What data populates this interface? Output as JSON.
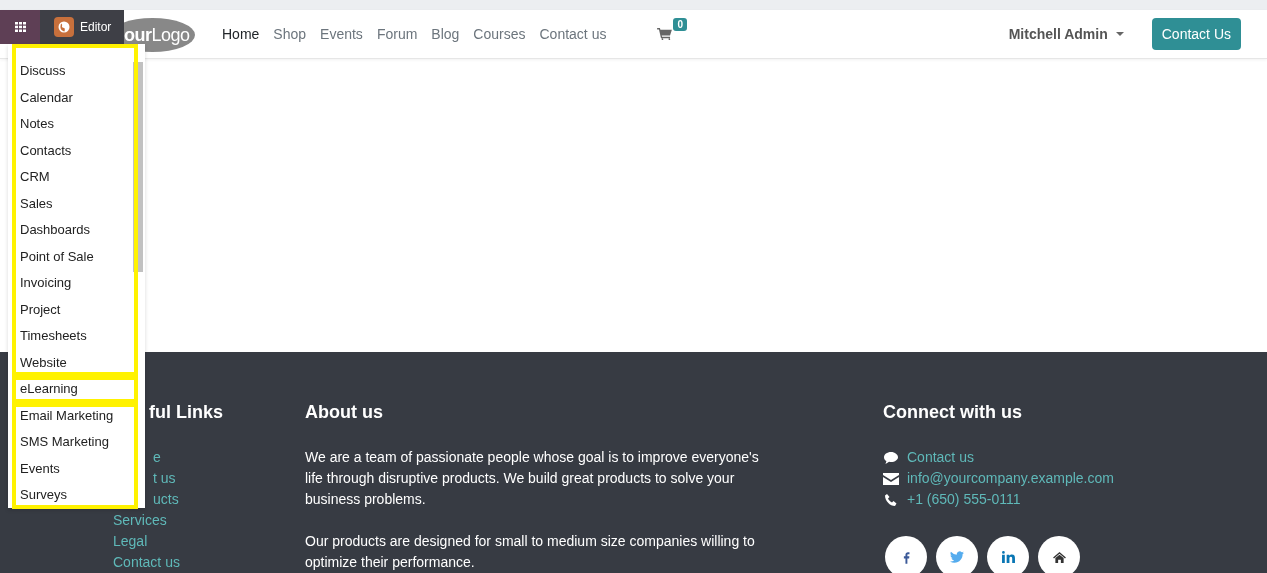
{
  "editor_bar": {
    "editor_label": "Editor"
  },
  "navbar": {
    "logo": "**our**Logo",
    "links": [
      {
        "label": "Home",
        "selected": true
      },
      {
        "label": "Shop",
        "selected": false
      },
      {
        "label": "Events",
        "selected": false
      },
      {
        "label": "Forum",
        "selected": false
      },
      {
        "label": "Blog",
        "selected": false
      },
      {
        "label": "Courses",
        "selected": false
      },
      {
        "label": "Contact us",
        "selected": false
      }
    ],
    "cart_count": "0",
    "user": "Mitchell Admin",
    "cta": "Contact Us"
  },
  "app_menu": {
    "groups": [
      {
        "highlighted": true,
        "items": [
          "Discuss",
          "Calendar",
          "Notes",
          "Contacts",
          "CRM",
          "Sales",
          "Dashboards",
          "Point of Sale",
          "Invoicing",
          "Project",
          "Timesheets",
          "Website"
        ]
      },
      {
        "highlighted": true,
        "items": [
          "eLearning"
        ]
      },
      {
        "highlighted": true,
        "items": [
          "Email Marketing",
          "SMS Marketing",
          "Events",
          "Surveys"
        ]
      }
    ]
  },
  "footer": {
    "useful_links": {
      "title": "ful Links",
      "links": [
        {
          "text": "e",
          "clipped": true
        },
        {
          "text": "t us",
          "clipped": true
        },
        {
          "text": "ucts",
          "clipped": true
        },
        {
          "text": "Services",
          "clipped": false
        },
        {
          "text": "Legal",
          "clipped": false
        },
        {
          "text": "Contact us",
          "clipped": false
        }
      ]
    },
    "about": {
      "title": "About us",
      "paragraphs": [
        "We are a team of passionate people whose goal is to improve everyone's life through disruptive products. We build great products to solve your business problems.",
        "Our products are designed for small to medium size companies willing to optimize their performance."
      ]
    },
    "connect": {
      "title": "Connect with us",
      "contacts": [
        {
          "kind": "chat",
          "text": "Contact us"
        },
        {
          "kind": "mail",
          "text": "info@yourcompany.example.com"
        },
        {
          "kind": "phone",
          "text": "+1 (650) 555-0111"
        }
      ],
      "social": [
        {
          "kind": "facebook"
        },
        {
          "kind": "twitter"
        },
        {
          "kind": "linkedin"
        },
        {
          "kind": "home"
        }
      ]
    }
  }
}
